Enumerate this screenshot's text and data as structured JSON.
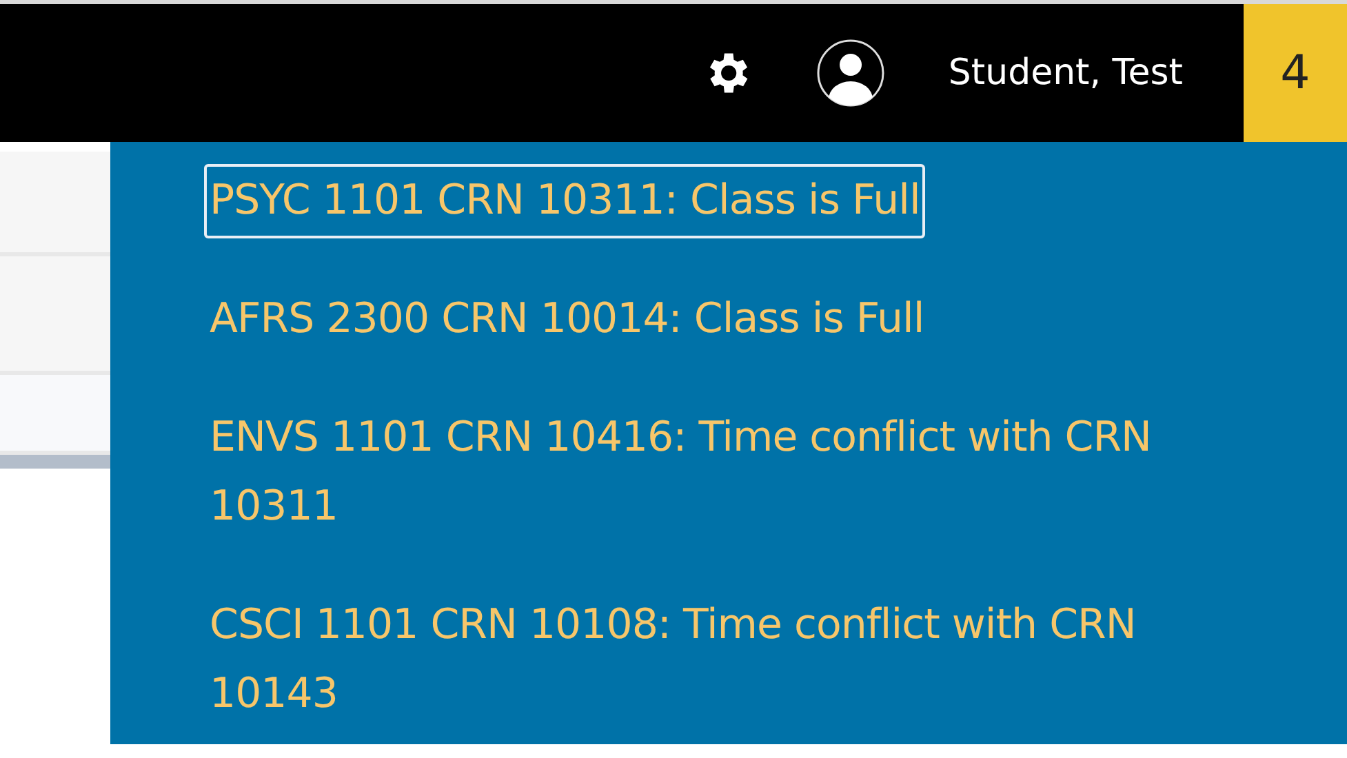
{
  "header": {
    "user_name": "Student, Test",
    "notification_count": "4"
  },
  "notifications": [
    {
      "text": "PSYC 1101 CRN 10311: Class is Full",
      "selected": true
    },
    {
      "text": "AFRS 2300 CRN 10014: Class is Full",
      "selected": false
    },
    {
      "text": "ENVS 1101 CRN 10416: Time conflict with CRN 10311",
      "selected": false
    },
    {
      "text": "CSCI 1101 CRN 10108: Time conflict with CRN 10143",
      "selected": false
    }
  ]
}
